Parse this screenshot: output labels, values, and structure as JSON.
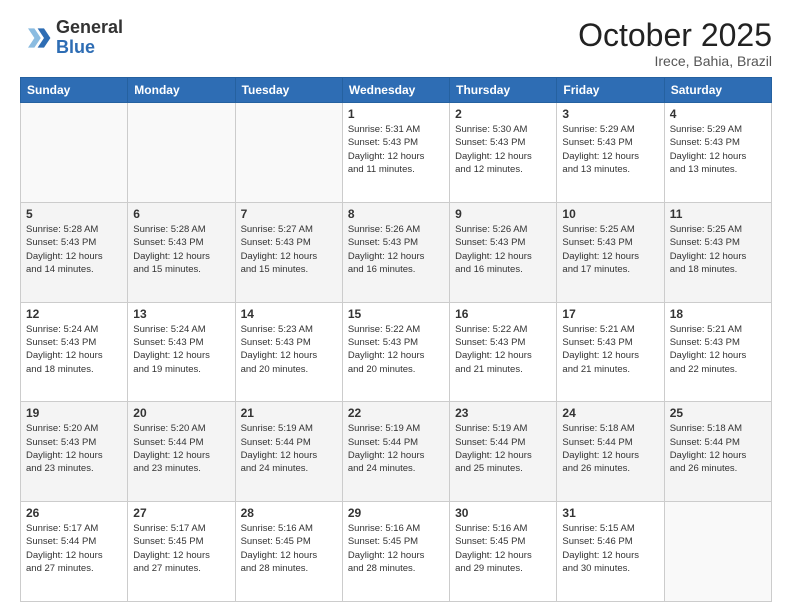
{
  "header": {
    "logo_general": "General",
    "logo_blue": "Blue",
    "month": "October 2025",
    "location": "Irece, Bahia, Brazil"
  },
  "days_of_week": [
    "Sunday",
    "Monday",
    "Tuesday",
    "Wednesday",
    "Thursday",
    "Friday",
    "Saturday"
  ],
  "weeks": [
    [
      {
        "day": "",
        "info": ""
      },
      {
        "day": "",
        "info": ""
      },
      {
        "day": "",
        "info": ""
      },
      {
        "day": "1",
        "info": "Sunrise: 5:31 AM\nSunset: 5:43 PM\nDaylight: 12 hours\nand 11 minutes."
      },
      {
        "day": "2",
        "info": "Sunrise: 5:30 AM\nSunset: 5:43 PM\nDaylight: 12 hours\nand 12 minutes."
      },
      {
        "day": "3",
        "info": "Sunrise: 5:29 AM\nSunset: 5:43 PM\nDaylight: 12 hours\nand 13 minutes."
      },
      {
        "day": "4",
        "info": "Sunrise: 5:29 AM\nSunset: 5:43 PM\nDaylight: 12 hours\nand 13 minutes."
      }
    ],
    [
      {
        "day": "5",
        "info": "Sunrise: 5:28 AM\nSunset: 5:43 PM\nDaylight: 12 hours\nand 14 minutes."
      },
      {
        "day": "6",
        "info": "Sunrise: 5:28 AM\nSunset: 5:43 PM\nDaylight: 12 hours\nand 15 minutes."
      },
      {
        "day": "7",
        "info": "Sunrise: 5:27 AM\nSunset: 5:43 PM\nDaylight: 12 hours\nand 15 minutes."
      },
      {
        "day": "8",
        "info": "Sunrise: 5:26 AM\nSunset: 5:43 PM\nDaylight: 12 hours\nand 16 minutes."
      },
      {
        "day": "9",
        "info": "Sunrise: 5:26 AM\nSunset: 5:43 PM\nDaylight: 12 hours\nand 16 minutes."
      },
      {
        "day": "10",
        "info": "Sunrise: 5:25 AM\nSunset: 5:43 PM\nDaylight: 12 hours\nand 17 minutes."
      },
      {
        "day": "11",
        "info": "Sunrise: 5:25 AM\nSunset: 5:43 PM\nDaylight: 12 hours\nand 18 minutes."
      }
    ],
    [
      {
        "day": "12",
        "info": "Sunrise: 5:24 AM\nSunset: 5:43 PM\nDaylight: 12 hours\nand 18 minutes."
      },
      {
        "day": "13",
        "info": "Sunrise: 5:24 AM\nSunset: 5:43 PM\nDaylight: 12 hours\nand 19 minutes."
      },
      {
        "day": "14",
        "info": "Sunrise: 5:23 AM\nSunset: 5:43 PM\nDaylight: 12 hours\nand 20 minutes."
      },
      {
        "day": "15",
        "info": "Sunrise: 5:22 AM\nSunset: 5:43 PM\nDaylight: 12 hours\nand 20 minutes."
      },
      {
        "day": "16",
        "info": "Sunrise: 5:22 AM\nSunset: 5:43 PM\nDaylight: 12 hours\nand 21 minutes."
      },
      {
        "day": "17",
        "info": "Sunrise: 5:21 AM\nSunset: 5:43 PM\nDaylight: 12 hours\nand 21 minutes."
      },
      {
        "day": "18",
        "info": "Sunrise: 5:21 AM\nSunset: 5:43 PM\nDaylight: 12 hours\nand 22 minutes."
      }
    ],
    [
      {
        "day": "19",
        "info": "Sunrise: 5:20 AM\nSunset: 5:43 PM\nDaylight: 12 hours\nand 23 minutes."
      },
      {
        "day": "20",
        "info": "Sunrise: 5:20 AM\nSunset: 5:44 PM\nDaylight: 12 hours\nand 23 minutes."
      },
      {
        "day": "21",
        "info": "Sunrise: 5:19 AM\nSunset: 5:44 PM\nDaylight: 12 hours\nand 24 minutes."
      },
      {
        "day": "22",
        "info": "Sunrise: 5:19 AM\nSunset: 5:44 PM\nDaylight: 12 hours\nand 24 minutes."
      },
      {
        "day": "23",
        "info": "Sunrise: 5:19 AM\nSunset: 5:44 PM\nDaylight: 12 hours\nand 25 minutes."
      },
      {
        "day": "24",
        "info": "Sunrise: 5:18 AM\nSunset: 5:44 PM\nDaylight: 12 hours\nand 26 minutes."
      },
      {
        "day": "25",
        "info": "Sunrise: 5:18 AM\nSunset: 5:44 PM\nDaylight: 12 hours\nand 26 minutes."
      }
    ],
    [
      {
        "day": "26",
        "info": "Sunrise: 5:17 AM\nSunset: 5:44 PM\nDaylight: 12 hours\nand 27 minutes."
      },
      {
        "day": "27",
        "info": "Sunrise: 5:17 AM\nSunset: 5:45 PM\nDaylight: 12 hours\nand 27 minutes."
      },
      {
        "day": "28",
        "info": "Sunrise: 5:16 AM\nSunset: 5:45 PM\nDaylight: 12 hours\nand 28 minutes."
      },
      {
        "day": "29",
        "info": "Sunrise: 5:16 AM\nSunset: 5:45 PM\nDaylight: 12 hours\nand 28 minutes."
      },
      {
        "day": "30",
        "info": "Sunrise: 5:16 AM\nSunset: 5:45 PM\nDaylight: 12 hours\nand 29 minutes."
      },
      {
        "day": "31",
        "info": "Sunrise: 5:15 AM\nSunset: 5:46 PM\nDaylight: 12 hours\nand 30 minutes."
      },
      {
        "day": "",
        "info": ""
      }
    ]
  ]
}
